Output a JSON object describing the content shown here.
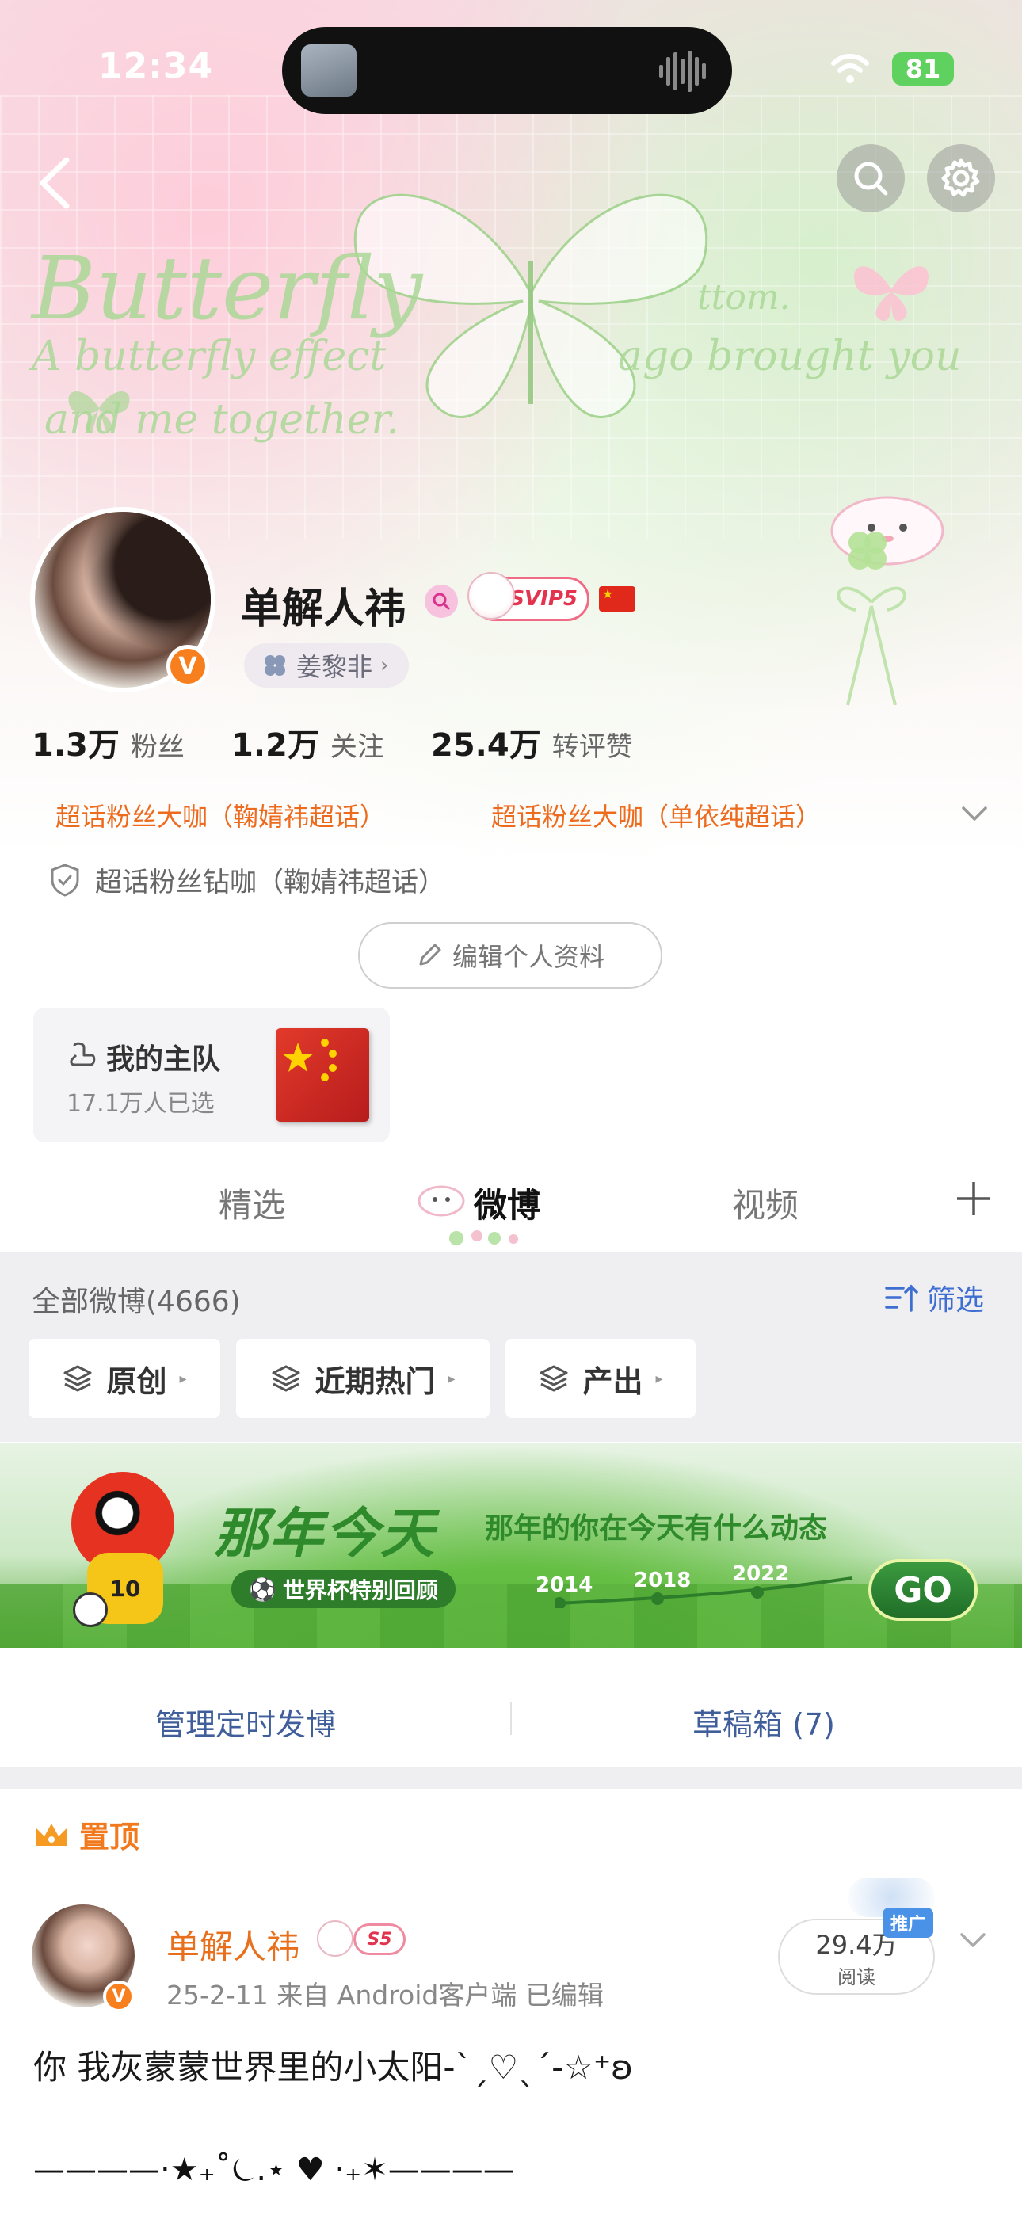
{
  "status_bar": {
    "time": "12:34",
    "battery": "81"
  },
  "banner": {
    "decor_text_1": "Butterfly",
    "decor_text_2": "A butterfly effect",
    "decor_text_3": "ago brought you",
    "decor_text_4": "and me together.",
    "decor_text_5": "ttom."
  },
  "profile": {
    "username": "单解人祎",
    "svip_label": "SVIP5",
    "fan_tag": "姜黎非",
    "verified_mark": "V"
  },
  "stats": [
    {
      "value": "1.3万",
      "label": "粉丝"
    },
    {
      "value": "1.2万",
      "label": "关注"
    },
    {
      "value": "25.4万",
      "label": "转评赞"
    }
  ],
  "badges": {
    "badge_1": "超话粉丝大咖（鞠婧祎超话）",
    "badge_2": "超话粉丝大咖（单依纯超话）",
    "diamond": "超话粉丝钻咖（鞠婧祎超话）"
  },
  "edit_profile_label": "编辑个人资料",
  "team_card": {
    "title": "我的主队",
    "subtitle": "17.1万人已选"
  },
  "tabs": [
    {
      "label": "精选",
      "active": false
    },
    {
      "label": "微博",
      "active": true
    },
    {
      "label": "视频",
      "active": false
    }
  ],
  "filter": {
    "all_weibo": "全部微博(4666)",
    "filter_label": "筛选",
    "chips": [
      "原创",
      "近期热门",
      "产出"
    ]
  },
  "ad": {
    "title": "那年今天",
    "subtitle": "那年的你在今天有什么动态",
    "pill": "世界杯特别回顾",
    "years": [
      "2014",
      "2018",
      "2022"
    ],
    "go_label": "GO",
    "mascot_number": "10"
  },
  "manage": {
    "scheduled": "管理定时发博",
    "drafts": "草稿箱 (7)"
  },
  "post": {
    "pinned_label": "置顶",
    "author": "单解人祎",
    "level_badge": "S5",
    "meta": "25-2-11  来自 Android客户端  已编辑",
    "read_count": "29.4万",
    "read_label": "阅读",
    "promo_label": "推广",
    "text": "你 我灰蒙蒙世界里的小太阳-ˋˏ♡ˎˊ-☆⁺ʚ",
    "line": "————·★₊˚⏾.⋆ ♥ ·₊✶————"
  },
  "colors": {
    "accent_orange": "#f07a1d",
    "link_blue": "#3f5e9a",
    "filter_blue": "#3f6ed2",
    "ad_green": "#2f8a2c"
  }
}
